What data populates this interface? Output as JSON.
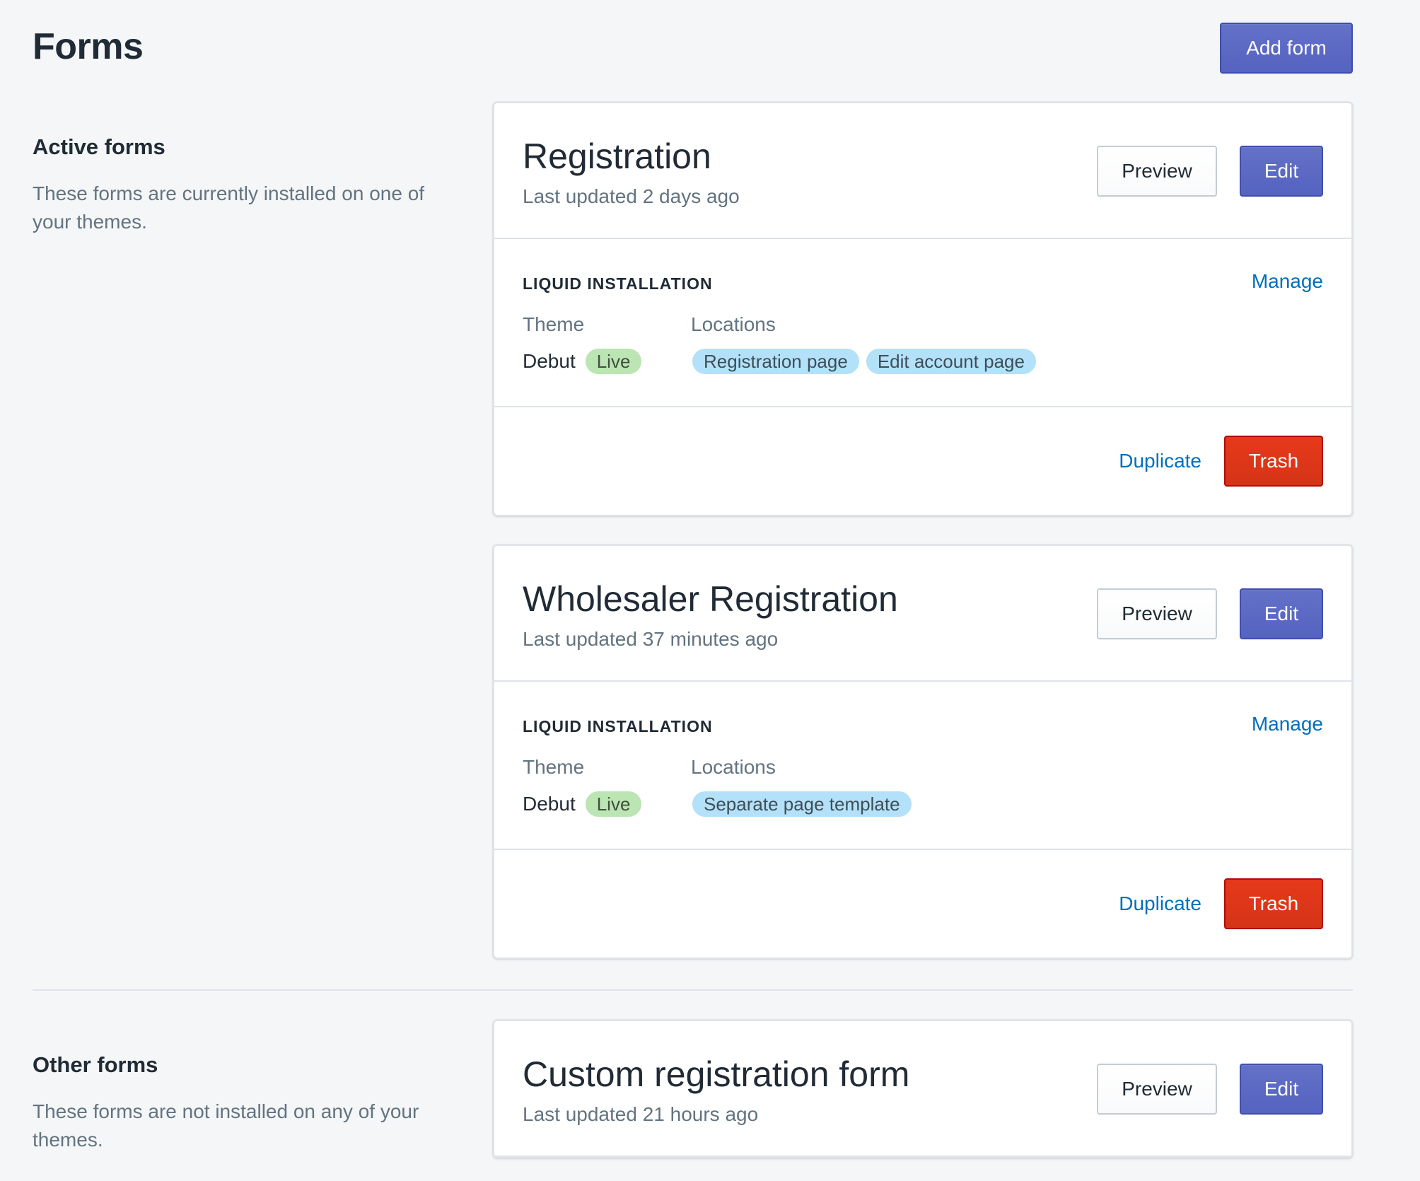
{
  "page": {
    "title": "Forms",
    "add_form_label": "Add form"
  },
  "active_section": {
    "heading": "Active forms",
    "description": "These forms are currently installed on one of your themes.",
    "forms": [
      {
        "title": "Registration",
        "updated": "Last updated 2 days ago",
        "preview_label": "Preview",
        "edit_label": "Edit",
        "install_title": "LIQUID INSTALLATION",
        "manage_label": "Manage",
        "theme_label": "Theme",
        "locations_label": "Locations",
        "theme_name": "Debut",
        "theme_status": "Live",
        "locations": [
          "Registration page",
          "Edit account page"
        ],
        "duplicate_label": "Duplicate",
        "trash_label": "Trash"
      },
      {
        "title": "Wholesaler Registration",
        "updated": "Last updated 37 minutes ago",
        "preview_label": "Preview",
        "edit_label": "Edit",
        "install_title": "LIQUID INSTALLATION",
        "manage_label": "Manage",
        "theme_label": "Theme",
        "locations_label": "Locations",
        "theme_name": "Debut",
        "theme_status": "Live",
        "locations": [
          "Separate page template"
        ],
        "duplicate_label": "Duplicate",
        "trash_label": "Trash"
      }
    ]
  },
  "other_section": {
    "heading": "Other forms",
    "description": "These forms are not installed on any of your themes.",
    "forms": [
      {
        "title": "Custom registration form",
        "updated": "Last updated 21 hours ago",
        "preview_label": "Preview",
        "edit_label": "Edit"
      }
    ]
  },
  "colors": {
    "primary": "#5c6ac4",
    "destructive": "#de3618",
    "link": "#006fbb",
    "live_badge": "#bbe5b3",
    "location_badge": "#b4e1fa",
    "background": "#f4f6f8"
  }
}
